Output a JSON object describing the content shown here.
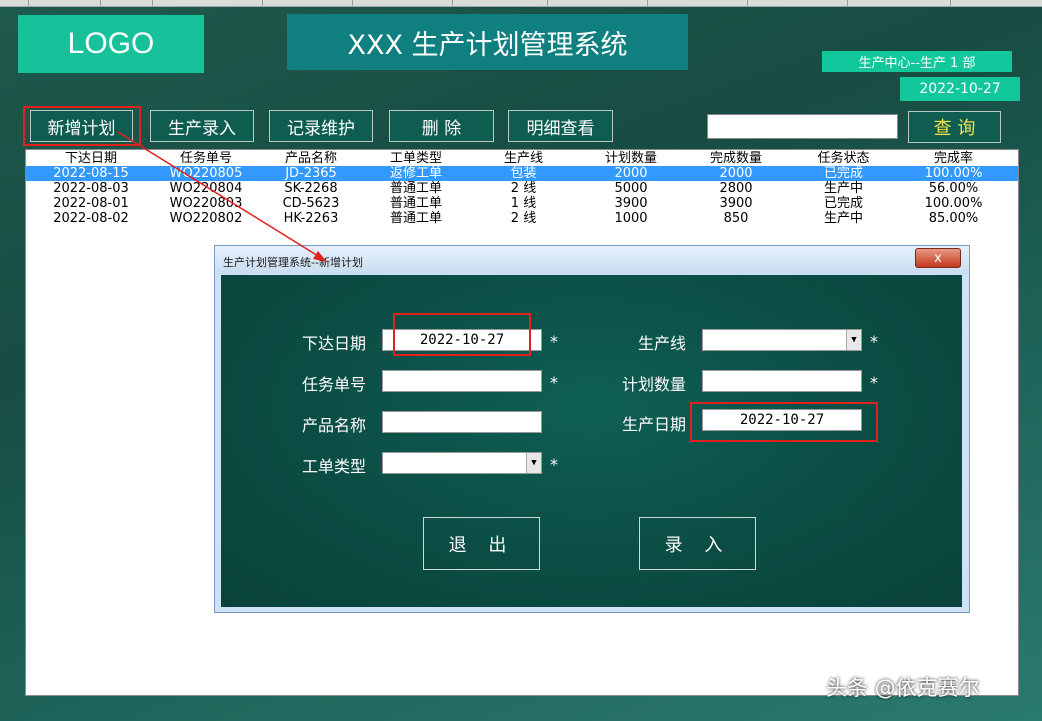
{
  "header": {
    "logo": "LOGO",
    "title": "XXX 生产计划管理系统",
    "department": "生产中心--生产 1 部",
    "date": "2022-10-27"
  },
  "nav": {
    "new_plan": "新增计划",
    "production_entry": "生产录入",
    "record_maintenance": "记录维护",
    "delete": "删 除",
    "detail_view": "明细查看",
    "search_value": "",
    "query": "查 询"
  },
  "table": {
    "headers": [
      "下达日期",
      "任务单号",
      "产品名称",
      "工单类型",
      "生产线",
      "计划数量",
      "完成数量",
      "任务状态",
      "完成率"
    ],
    "rows": [
      [
        "2022-08-15",
        "WO220805",
        "JD-2365",
        "返修工单",
        "包装",
        "2000",
        "2000",
        "已完成",
        "100.00%"
      ],
      [
        "2022-08-03",
        "WO220804",
        "SK-2268",
        "普通工单",
        "2 线",
        "5000",
        "2800",
        "生产中",
        "56.00%"
      ],
      [
        "2022-08-01",
        "WO220803",
        "CD-5623",
        "普通工单",
        "1 线",
        "3900",
        "3900",
        "已完成",
        "100.00%"
      ],
      [
        "2022-08-02",
        "WO220802",
        "HK-2263",
        "普通工单",
        "2 线",
        "1000",
        "850",
        "生产中",
        "85.00%"
      ]
    ],
    "selected_row": 0
  },
  "dialog": {
    "title": "生产计划管理系统--新增计划",
    "close": "x",
    "labels": {
      "issue_date": "下达日期",
      "task_no": "任务单号",
      "product_name": "产品名称",
      "order_type": "工单类型",
      "production_line": "生产线",
      "plan_qty": "计划数量",
      "production_date": "生产日期"
    },
    "values": {
      "issue_date": "2022-10-27",
      "task_no": "",
      "product_name": "",
      "order_type": "",
      "production_line": "",
      "plan_qty": "",
      "production_date": "2022-10-27"
    },
    "required_mark": "*",
    "exit": "退 出",
    "submit": "录 入"
  },
  "watermark": "头条 @依克赛尔",
  "colors": {
    "accent": "#12c79b",
    "title_bg": "#0f7f80",
    "highlight": "#e0211c",
    "selected_row": "#3399ff",
    "query_text": "#f2e14a"
  }
}
